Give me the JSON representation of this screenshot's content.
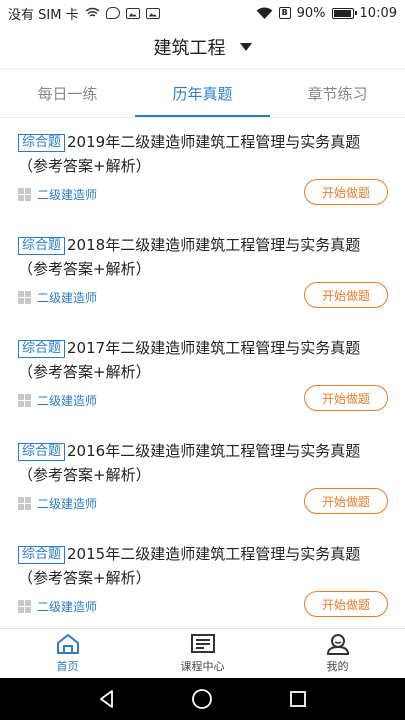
{
  "statusbar": {
    "carrier": "没有 SIM 卡",
    "battery": "90%",
    "time": "10:09"
  },
  "header": {
    "title": "建筑工程"
  },
  "tabs": [
    {
      "label": "每日一练",
      "active": false
    },
    {
      "label": "历年真题",
      "active": true
    },
    {
      "label": "章节练习",
      "active": false
    }
  ],
  "items": [
    {
      "tag": "综合题",
      "title": "2019年二级建造师建筑工程管理与实务真题（参考答案+解析）",
      "category": "二级建造师",
      "button": "开始做题"
    },
    {
      "tag": "综合题",
      "title": "2018年二级建造师建筑工程管理与实务真题（参考答案+解析）",
      "category": "二级建造师",
      "button": "开始做题"
    },
    {
      "tag": "综合题",
      "title": "2017年二级建造师建筑工程管理与实务真题（参考答案+解析）",
      "category": "二级建造师",
      "button": "开始做题"
    },
    {
      "tag": "综合题",
      "title": "2016年二级建造师建筑工程管理与实务真题（参考答案+解析）",
      "category": "二级建造师",
      "button": "开始做题"
    },
    {
      "tag": "综合题",
      "title": "2015年二级建造师建筑工程管理与实务真题（参考答案+解析）",
      "category": "二级建造师",
      "button": "开始做题"
    }
  ],
  "bottomnav": [
    {
      "label": "首页",
      "icon": "home-icon",
      "active": true
    },
    {
      "label": "课程中心",
      "icon": "course-icon",
      "active": false
    },
    {
      "label": "我的",
      "icon": "profile-icon",
      "active": false
    }
  ],
  "colors": {
    "accent": "#2a7dc9",
    "button": "#f07a2a"
  }
}
